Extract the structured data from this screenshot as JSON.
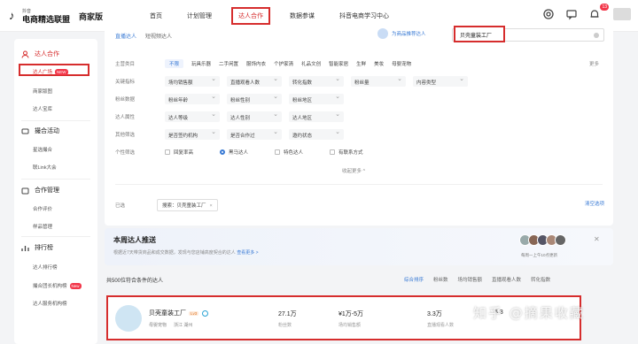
{
  "header": {
    "logo_small": "抖音",
    "logo_big": "电商精选联盟",
    "logo_tag": "商家版",
    "nav": [
      "首页",
      "计划管理",
      "达人合作",
      "数据参谋",
      "抖音电商学习中心"
    ],
    "notif_count": "13"
  },
  "sidebar": {
    "groups": [
      {
        "label": "达人合作",
        "items": [
          "达人广场",
          "商家版图",
          "达人宝库"
        ]
      },
      {
        "label": "撮合活动",
        "items": [
          "星选撮合",
          "联Link大会"
        ]
      },
      {
        "label": "合作管理",
        "items": [
          "合作评价",
          "样品管理"
        ]
      },
      {
        "label": "排行榜",
        "items": [
          "达人排行榜",
          "撮合团长机构榜",
          "达人服务机构榜"
        ]
      }
    ],
    "active_tag": "NEW",
    "new_tag": "New"
  },
  "search": {
    "tab_selected": "直播达人",
    "tab_other": "短视频达人",
    "invite": "为商品推荐达人",
    "query": "贝壳童装工厂"
  },
  "filters": {
    "category_label": "主营类目",
    "categories": [
      "不限",
      "玩具乐器",
      "二手闲置",
      "服饰内衣",
      "个护家清",
      "礼品文创",
      "智能家居",
      "生鲜",
      "美妆",
      "母婴宠物"
    ],
    "more": "更多",
    "key_label": "关键指标",
    "key_dds": [
      "场均销售额",
      "直播观看人数",
      "转化指数",
      "粉丝量",
      "内容类型"
    ],
    "fans_label": "粉丝数据",
    "fans_dds": [
      "粉丝年龄",
      "粉丝性别",
      "粉丝地区"
    ],
    "attr_label": "达人属性",
    "attr_dds": [
      "达人等级",
      "达人性别",
      "达人地区"
    ],
    "other_label": "其他筛选",
    "other_dds": [
      "是否签约机构",
      "是否合作过",
      "邀约状态"
    ],
    "personal_label": "个性筛选",
    "checks": [
      "回复率高",
      "黑马达人",
      "特色达人",
      "有联系方式"
    ],
    "collapse": "收起更多 ^",
    "selected_label": "已选",
    "selected_tag": "搜索：贝壳童装工厂",
    "clear_all": "清空选项"
  },
  "recommend": {
    "title": "本周达人推送",
    "subtitle": "根据近7天带货商品和成交数据，发现与您店铺高度契合的达人",
    "link": "查看更多 >",
    "note": "每周一上午10点更新"
  },
  "results": {
    "count_text": "共500位符合条件的达人",
    "sort": [
      "综合排序",
      "粉丝数",
      "场均销售额",
      "直播观看人数",
      "转化指数"
    ],
    "card": {
      "name": "贝壳童装工厂",
      "level": "Lv3",
      "category": "母婴宠物",
      "region": "浙江 湖州",
      "fans": "27.1万",
      "fans_label": "粉丝数",
      "sales": "¥1万-5万",
      "sales_label": "场均销售额",
      "viewers": "3.3万",
      "viewers_label": "直播观看人数",
      "extra": "5.3"
    }
  },
  "watermark": "知乎 @摘果收藏"
}
